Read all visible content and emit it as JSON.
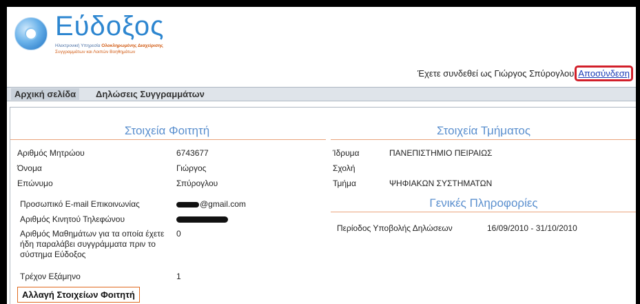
{
  "logo": {
    "name": "Εύδοξος",
    "subtitle_line1_prefix": "Ηλεκτρονική Υπηρεσία",
    "subtitle_line1_bold": "Ολοκληρωμένης Διαχείρισης",
    "subtitle_line2": "Συγγραμμάτων και Λοιπών Βοηθημάτων"
  },
  "account": {
    "logged_in_text": "Έχετε συνδεθεί ως Γιώργος Σπύρογλου",
    "logout_label": "Αποσύνδεση"
  },
  "nav": {
    "tabs": [
      {
        "label": "Αρχική σελίδα",
        "active": true
      },
      {
        "label": "Δηλώσεις Συγγραμμάτων",
        "active": false
      }
    ]
  },
  "student": {
    "title": "Στοιχεία Φοιτητή",
    "rows": [
      {
        "label": "Αριθμός Μητρώου",
        "value": "6743677"
      },
      {
        "label": "Όνομα",
        "value": "Γιώργος"
      },
      {
        "label": "Επώνυμο",
        "value": "Σπύρογλου"
      }
    ],
    "email_label": "Προσωπικό E-mail Επικοινωνίας",
    "email_domain": "@gmail.com",
    "phone_label": "Αριθμός Κινητού Τηλεφώνου",
    "courses_label": "Αριθμός Μαθημάτων για τα οποία έχετε ήδη παραλάβει συγγράμματα πριν το σύστημα Εύδοξος",
    "courses_value": "0",
    "semester_label": "Τρέχον Εξάμηνο",
    "semester_value": "1",
    "change_button": "Αλλαγή Στοιχείων Φοιτητή"
  },
  "department": {
    "title": "Στοιχεία Τμήματος",
    "rows": [
      {
        "label": "Ίδρυμα",
        "value": "ΠΑΝΕΠΙΣΤΗΜΙΟ ΠΕΙΡΑΙΩΣ"
      },
      {
        "label": "Σχολή",
        "value": ""
      },
      {
        "label": "Τμήμα",
        "value": "ΨΗΦΙΑΚΩΝ ΣΥΣΤΗΜΑΤΩΝ"
      }
    ]
  },
  "general": {
    "title": "Γενικές Πληροφορίες",
    "period_label": "Περίοδος Υποβολής Δηλώσεων",
    "period_value": "16/09/2010 - 31/10/2010"
  },
  "colors": {
    "section_title": "#5a8fce",
    "divider": "#e9a27a",
    "logout_highlight": "#d21f2a",
    "button_border": "#e06a1f"
  }
}
